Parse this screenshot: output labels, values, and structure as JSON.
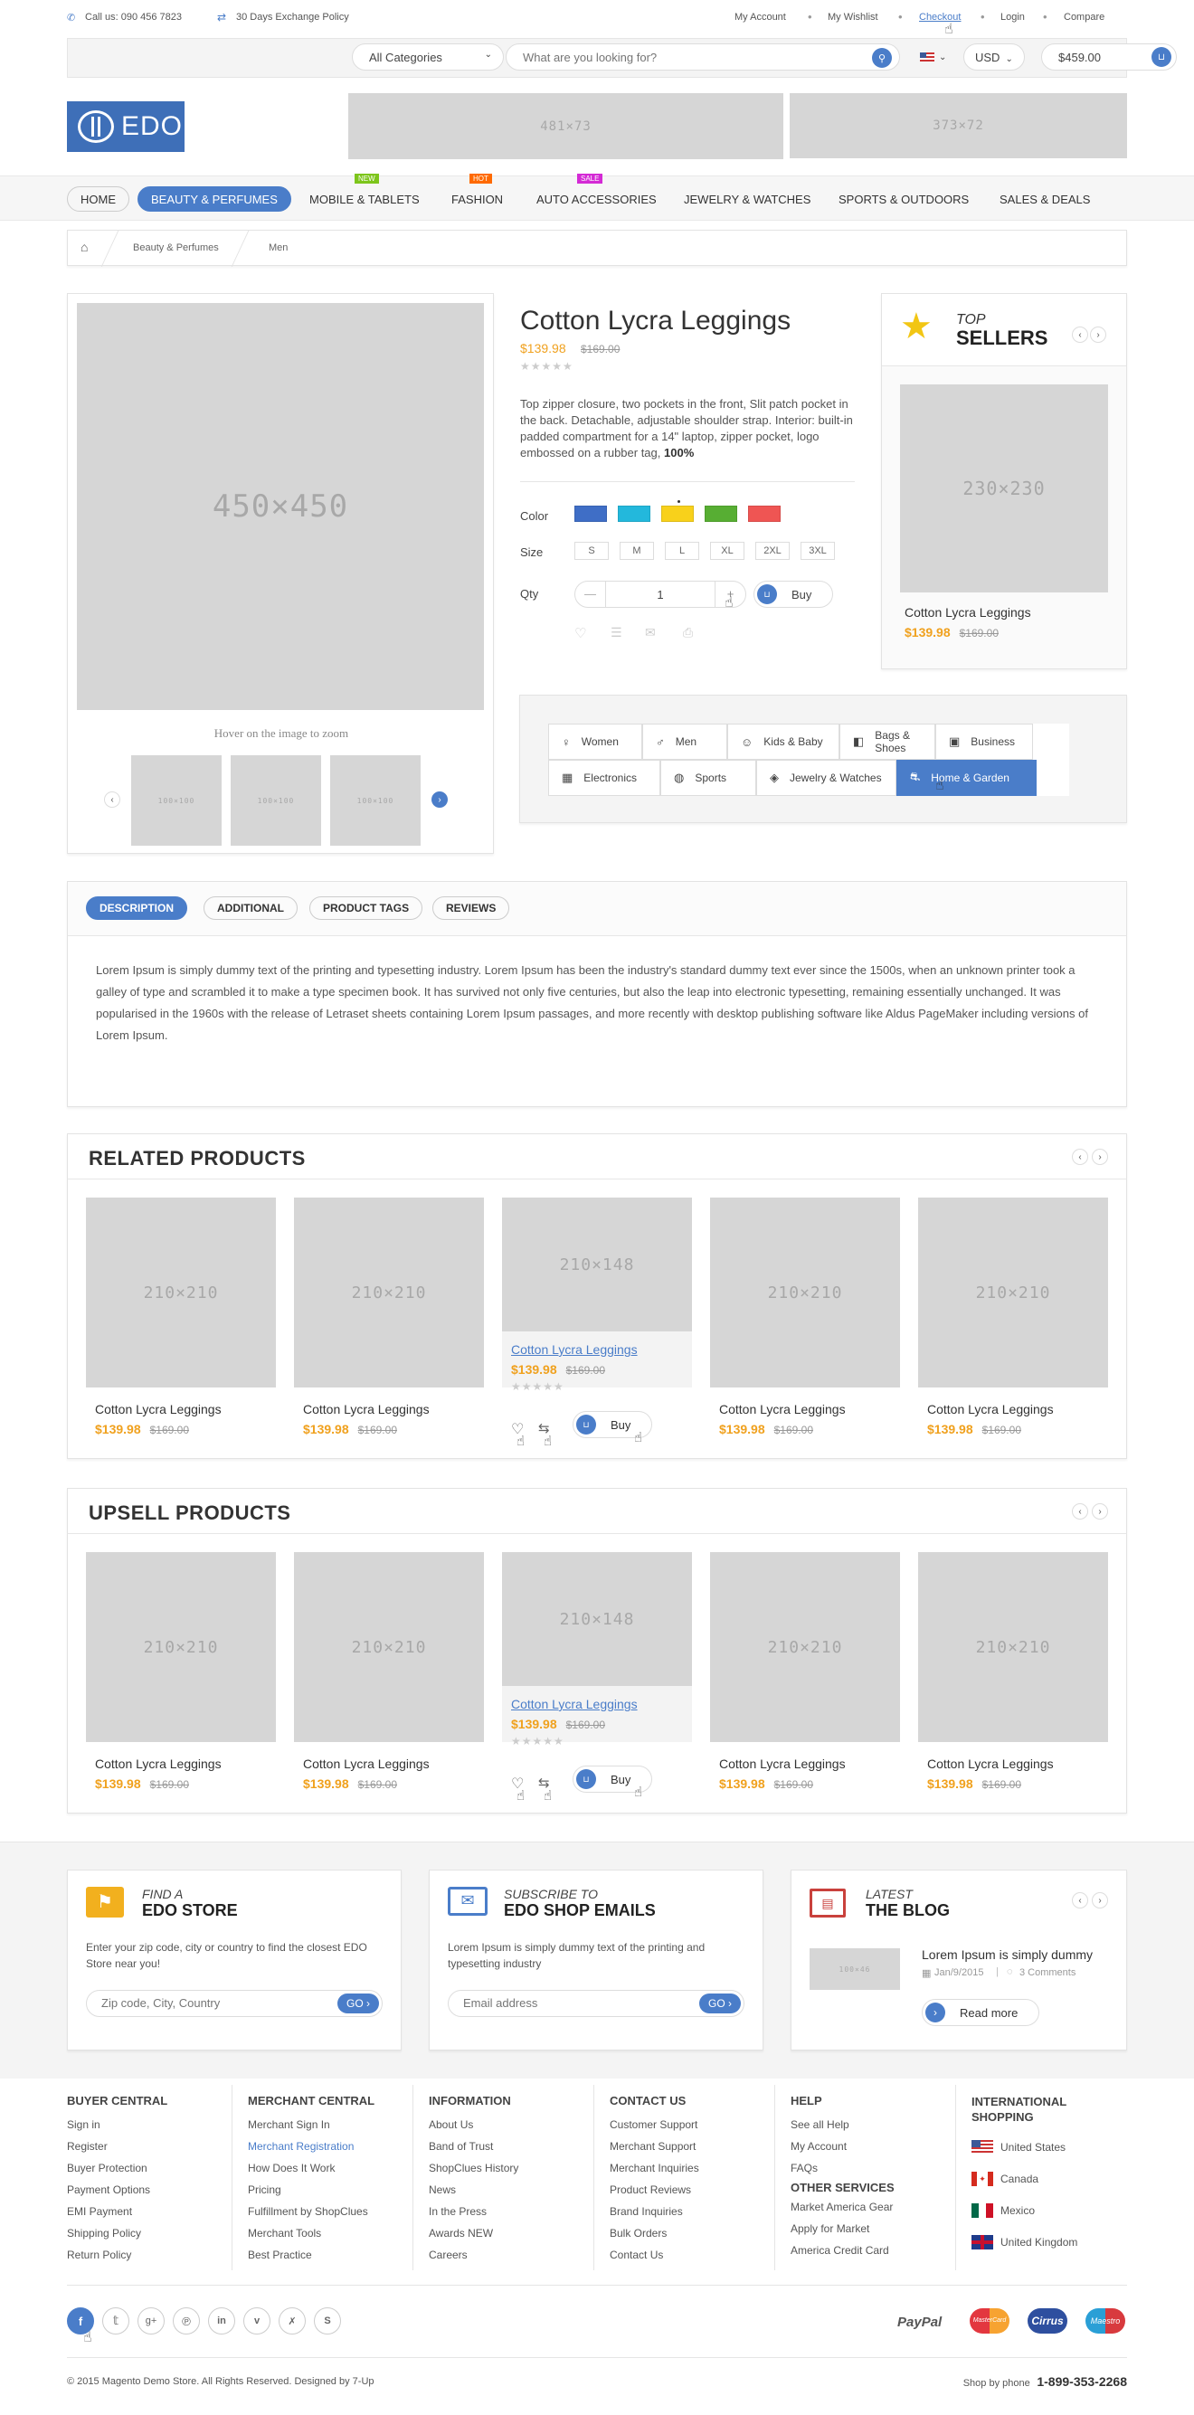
{
  "topbar": {
    "phone": "Call us: 090 456 7823",
    "exchange": "30 Days Exchange Policy",
    "links": [
      "My Account",
      "My Wishlist",
      "Checkout",
      "Login",
      "Compare"
    ]
  },
  "search": {
    "category": "All Categories",
    "placeholder": "What are you looking for?",
    "currency": "USD",
    "cart_total": "$459.00"
  },
  "brand": {
    "logo": "EDO"
  },
  "banners": {
    "b1": "481×73",
    "b2": "373×72"
  },
  "nav": {
    "items": [
      "HOME",
      "BEAUTY & PERFUMES",
      "MOBILE & TABLETS",
      "FASHION",
      "AUTO ACCESSORIES",
      "JEWELRY & WATCHES",
      "SPORTS & OUTDOORS",
      "SALES & DEALS"
    ],
    "badge_new": "NEW",
    "badge_hot": "HOT",
    "badge_sale": "SALE"
  },
  "breadcrumb": {
    "c1": "Beauty & Perfumes",
    "c2": "Men"
  },
  "product": {
    "image": "450×450",
    "zoom_hint": "Hover on the image to zoom",
    "thumb": "100×100",
    "title": "Cotton Lycra Leggings",
    "price": "$139.98",
    "old_price": "$169.00",
    "desc": "Top zipper closure, two pockets in the front, Slit patch pocket in the back. Detachable, adjustable shoulder strap. Interior: built-in padded compartment for a 14\" laptop, zipper pocket, logo embossed on a rubber tag,",
    "desc_bold": "100%",
    "color_label": "Color",
    "size_label": "Size",
    "qty_label": "Qty",
    "qty": "1",
    "buy": "Buy",
    "colors": [
      "#3f6ec6",
      "#23b8dc",
      "#f8d11b",
      "#57ae33",
      "#ef5553"
    ],
    "sizes": [
      "S",
      "M",
      "L",
      "XL",
      "2XL",
      "3XL"
    ]
  },
  "top_sellers": {
    "label_top": "TOP",
    "label_sellers": "SELLERS",
    "image": "230×230",
    "name": "Cotton Lycra Leggings",
    "price": "$139.98",
    "old_price": "$169.00"
  },
  "categories": [
    "Women",
    "Men",
    "Kids & Baby",
    "Bags & Shoes",
    "Business",
    "Electronics",
    "Sports",
    "Jewelry & Watches",
    "Home & Garden"
  ],
  "tabs": {
    "items": [
      "DESCRIPTION",
      "ADDITIONAL",
      "PRODUCT TAGS",
      "REVIEWS"
    ],
    "text": "Lorem Ipsum is simply dummy text of the printing and typesetting industry. Lorem Ipsum has been the industry's standard dummy text ever since the 1500s, when an unknown printer took a galley of type and scrambled it to make a type specimen book. It has survived not only five centuries, but also the leap into electronic typesetting, remaining essentially unchanged. It was popularised in the 1960s with the release of Letraset sheets containing Lorem Ipsum passages, and more recently with desktop publishing software like Aldus PageMaker including versions of Lorem Ipsum."
  },
  "related": {
    "title": "RELATED PRODUCTS",
    "image": "210×210",
    "hover_image": "210×148",
    "name": "Cotton Lycra Leggings",
    "price": "$139.98",
    "old_price": "$169.00",
    "buy": "Buy"
  },
  "upsell": {
    "title": "UPSELL PRODUCTS",
    "image": "210×210",
    "hover_image": "210×148",
    "name": "Cotton Lycra Leggings",
    "price": "$139.98",
    "old_price": "$169.00",
    "buy": "Buy"
  },
  "promo": {
    "store": {
      "kicker": "FIND A",
      "title": "EDO STORE",
      "text": "Enter your zip code, city or country to find the closest EDO Store near you!",
      "placeholder": "Zip code, City, Country",
      "go": "GO"
    },
    "subscribe": {
      "kicker": "SUBSCRIBE TO",
      "title": "EDO SHOP EMAILS",
      "text": "Lorem Ipsum is simply dummy text of the printing and typesetting industry",
      "placeholder": "Email address",
      "go": "GO"
    },
    "blog": {
      "kicker": "LATEST",
      "title": "THE BLOG",
      "thumb": "100×46",
      "post": "Lorem Ipsum is simply dummy",
      "date": "Jan/9/2015",
      "comments": "3 Comments",
      "read_more": "Read more"
    }
  },
  "footer": {
    "buyer": {
      "title": "BUYER CENTRAL",
      "links": [
        "Sign in",
        "Register",
        "Buyer Protection",
        "Payment Options",
        "EMI Payment",
        "Shipping Policy",
        "Return Policy"
      ]
    },
    "merchant": {
      "title": "MERCHANT CENTRAL",
      "links": [
        "Merchant Sign In",
        "Merchant Registration",
        "How Does It Work",
        "Pricing",
        "Fulfillment by ShopClues",
        "Merchant Tools",
        "Best Practice"
      ]
    },
    "info": {
      "title": "INFORMATION",
      "links": [
        "About Us",
        "Band of Trust",
        "ShopClues History",
        "News",
        "In the Press",
        "Awards NEW",
        "Careers"
      ]
    },
    "contact": {
      "title": "CONTACT US",
      "links": [
        "Customer Support",
        "Merchant Support",
        "Merchant Inquiries",
        "Product Reviews",
        "Brand Inquiries",
        "Bulk Orders",
        "Contact Us"
      ]
    },
    "help": {
      "title": "HELP",
      "links": [
        "See all Help",
        "My Account",
        "FAQs"
      ],
      "other_title": "OTHER SERVICES",
      "other": [
        "Market America Gear",
        "Apply for Market",
        "America Credit Card"
      ]
    },
    "intl": {
      "title": "INTERNATIONAL SHOPPING",
      "countries": [
        "United States",
        "Canada",
        "Mexico",
        "United Kingdom"
      ]
    },
    "payments": [
      "PayPal",
      "MasterCard",
      "Cirrus",
      "Maestro"
    ],
    "copyright": "© 2015 Magento Demo Store. All Rights Reserved. Designed by 7-Up",
    "phone_label": "Shop by phone",
    "phone": "1-899-353-2268"
  }
}
